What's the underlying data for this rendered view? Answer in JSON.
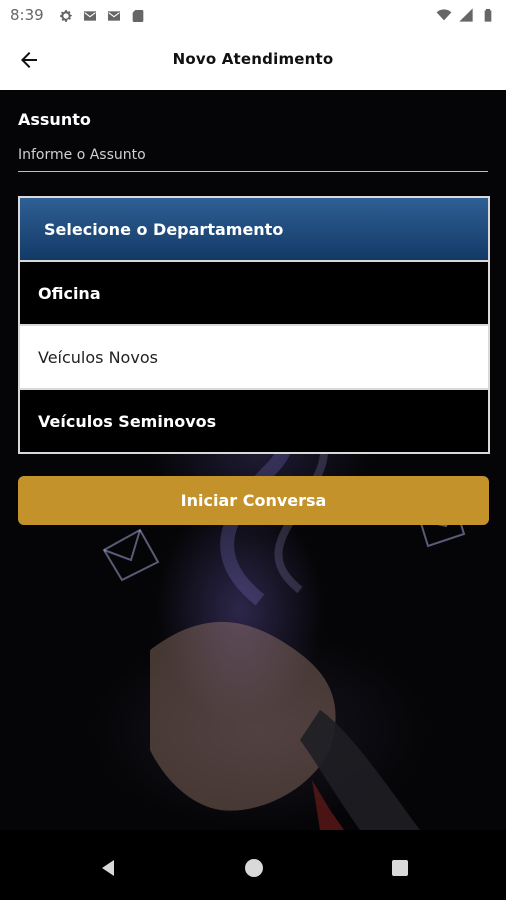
{
  "status_bar": {
    "time": "8:39",
    "icons_left": [
      "settings-icon",
      "gmail-icon",
      "gmail-icon",
      "sd-card-icon"
    ],
    "icons_right": [
      "wifi-icon",
      "signal-icon",
      "battery-icon"
    ]
  },
  "app_bar": {
    "title": "Novo Atendimento",
    "back_icon": "arrow-left-icon"
  },
  "form": {
    "subject_label": "Assunto",
    "subject_placeholder": "Informe o Assunto"
  },
  "department_list": {
    "header": "Selecione o Departamento",
    "items": [
      {
        "label": "Oficina",
        "selected": false
      },
      {
        "label": "Veículos Novos",
        "selected": true
      },
      {
        "label": "Veículos Seminovos",
        "selected": false
      }
    ]
  },
  "cta": {
    "label": "Iniciar Conversa"
  },
  "colors": {
    "accent": "#c4922b",
    "header_blue_top": "#2f5f95",
    "header_blue_bottom": "#123a66"
  },
  "nav_bar": {
    "icons": [
      "back-triangle-icon",
      "home-circle-icon",
      "recents-square-icon"
    ]
  }
}
